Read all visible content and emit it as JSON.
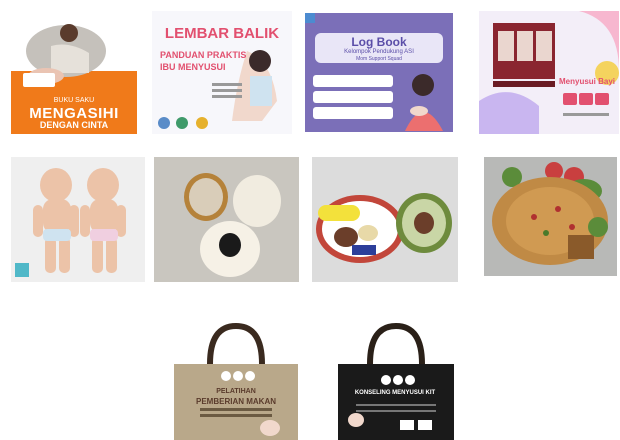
{
  "products": [
    {
      "name": "book-cover-orange",
      "top": "BUKU SAKU",
      "title": "MENGASIHI",
      "subtitle": "DENGAN CINTA"
    },
    {
      "name": "flipchart",
      "title1": "LEMBAR BALIK",
      "title2": "PANDUAN PRAKTIS IBU MENYUSUI"
    },
    {
      "name": "log-book",
      "title": "Log Book",
      "subtitle": "Kelompok Pendukung ASI",
      "subtitle2": "Mom Support Squad"
    },
    {
      "name": "counseling-kit-box",
      "title": "Menyusui Bayi"
    },
    {
      "name": "baby-dolls"
    },
    {
      "name": "breast-models"
    },
    {
      "name": "food-models"
    },
    {
      "name": "fried-rice-photo"
    },
    {
      "name": "tote-bag-beige",
      "title1": "PELATIHAN",
      "title2": "PEMBERIAN MAKAN"
    },
    {
      "name": "tote-bag-black",
      "title": "KONSELING MENYUSUI KIT"
    }
  ],
  "colors": {
    "orange": "#f07a1a",
    "purple": "#7b6fb8",
    "pink": "#e2506f",
    "bag-beige": "#b9a88a",
    "bag-black": "#1a1a1a"
  }
}
